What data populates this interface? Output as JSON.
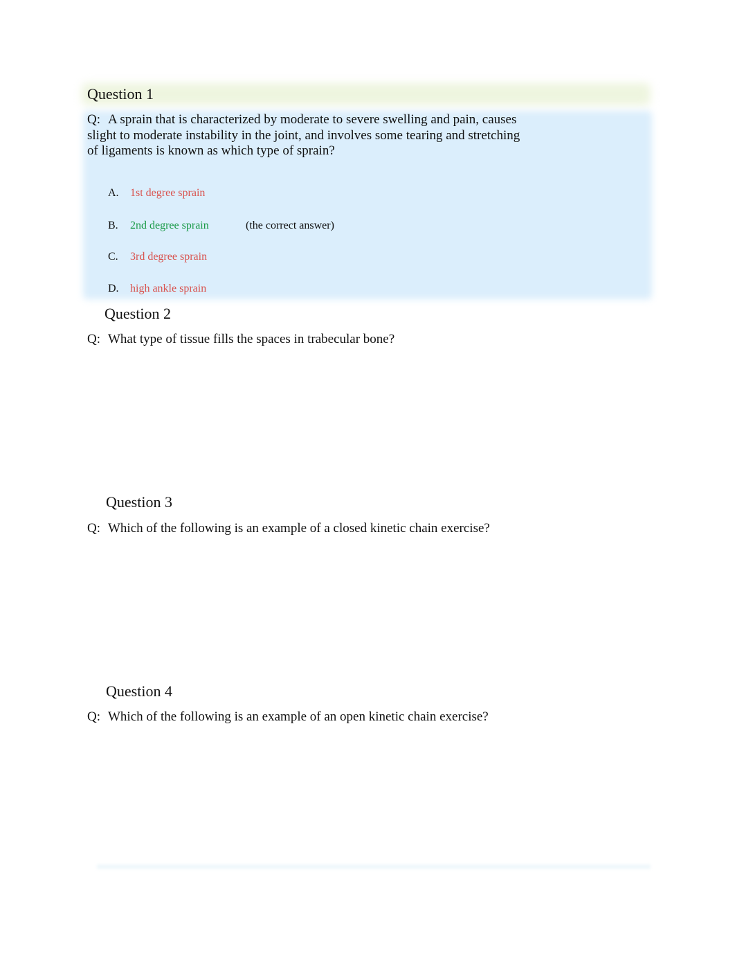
{
  "questions": [
    {
      "title": "Question 1",
      "prefix": "Q:",
      "text": "A sprain that is characterized by moderate to severe swelling and pain, causes slight to moderate instability in the joint, and involves some tearing and stretching of ligaments is known as which type of sprain?",
      "text_lines": [
        "A sprain that is characterized by moderate to severe swelling and pain, causes",
        "slight to moderate instability in the joint, and involves some tearing and stretching",
        "of ligaments is known as which type of sprain?"
      ],
      "options": [
        {
          "letter": "A.",
          "label": "1st degree sprain",
          "status": "incorrect"
        },
        {
          "letter": "B.",
          "label": "2nd degree sprain",
          "status": "correct",
          "note": "(the correct answer)"
        },
        {
          "letter": "C.",
          "label": "3rd degree sprain",
          "status": "incorrect"
        },
        {
          "letter": "D.",
          "label": "high ankle sprain",
          "status": "incorrect"
        }
      ]
    },
    {
      "title": "Question 2",
      "prefix": "Q:",
      "text": "What type of tissue fills the spaces in trabecular bone?"
    },
    {
      "title": "Question 3",
      "prefix": "Q:",
      "text": "Which of the following is an example of a closed kinetic chain exercise?"
    },
    {
      "title": "Question 4",
      "prefix": "Q:",
      "text": "Which of the following is an example of an open kinetic chain exercise?"
    }
  ],
  "colors": {
    "incorrect": "#d9534f",
    "correct": "#1a9a48",
    "highlight_blue": "#dbeefc",
    "highlight_green": "#eef5df"
  }
}
